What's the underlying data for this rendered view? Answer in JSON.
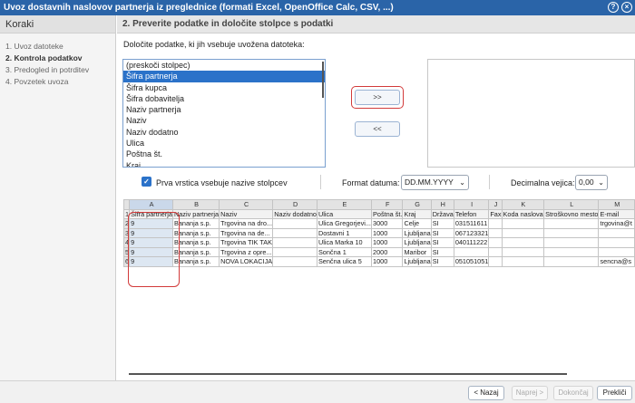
{
  "window": {
    "title": "Uvoz dostavnih naslovov partnerja iz preglednice (formati Excel, OpenOffice Calc, CSV, ...)",
    "help_icon": "?",
    "close_icon": "×"
  },
  "steps": {
    "title": "Koraki",
    "items": [
      {
        "label": "1. Uvoz datoteke"
      },
      {
        "label": "2. Kontrola podatkov"
      },
      {
        "label": "3. Predogled in potrditev"
      },
      {
        "label": "4. Povzetek uvoza"
      }
    ]
  },
  "main": {
    "header": "2. Preverite podatke in določite stolpce s podatki",
    "instruction": "Določite podatke, ki jih vsebuje uvožena datoteka:",
    "fields": [
      {
        "label": "(preskoči stolpec)"
      },
      {
        "label": "Šifra partnerja"
      },
      {
        "label": "Šifra kupca"
      },
      {
        "label": "Šifra dobavitelja"
      },
      {
        "label": "Naziv partnerja"
      },
      {
        "label": "Naziv"
      },
      {
        "label": "Naziv dodatno"
      },
      {
        "label": "Ulica"
      },
      {
        "label": "Poštna št."
      },
      {
        "label": "Kraj"
      }
    ],
    "add_button": ">>",
    "remove_button": "<<",
    "first_row_checkbox": "Prva vrstica vsebuje nazive stolpcev",
    "checkmark": "✓",
    "date_format_label": "Format datuma:",
    "date_format_value": "DD.MM.YYYY",
    "decimal_label": "Decimalna vejica:",
    "decimal_value": "0,00",
    "chevron": "⌄"
  },
  "grid": {
    "letters": [
      "A",
      "B",
      "C",
      "D",
      "E",
      "F",
      "G",
      "H",
      "I",
      "J",
      "K",
      "L",
      "M"
    ],
    "rows": [
      {
        "num": "1",
        "cells": [
          "Šifra partnerja",
          "Naziv partnerja",
          "Naziv",
          "Naziv dodatno",
          "Ulica",
          "Poštna št.",
          "Kraj",
          "Država",
          "Telefon",
          "Fax",
          "Koda naslova",
          "Stroškovno mesto",
          "E-mail"
        ]
      },
      {
        "num": "2",
        "cells": [
          "9",
          "Bananja s.p.",
          "Trgovina na dro...",
          "",
          "Ulica Gregorjevi...",
          "3000",
          "Celje",
          "SI",
          "031511611",
          "",
          "",
          "",
          "trgovina@t"
        ]
      },
      {
        "num": "3",
        "cells": [
          "9",
          "Bananja s.p.",
          "Trgovina na de...",
          "",
          "Dostavni 1",
          "1000",
          "Ljubljana",
          "SI",
          "067123321",
          "",
          "",
          "",
          ""
        ]
      },
      {
        "num": "4",
        "cells": [
          "9",
          "Bananja s.p.",
          "Trgovina TIK TAK",
          "",
          "Ulica Marka 10",
          "1000",
          "Ljubljana",
          "SI",
          "040111222",
          "",
          "",
          "",
          ""
        ]
      },
      {
        "num": "5",
        "cells": [
          "9",
          "Bananja s.p.",
          "Trgovina z opre...",
          "",
          "Sončna 1",
          "2000",
          "Maribor",
          "SI",
          "",
          "",
          "",
          "",
          ""
        ]
      },
      {
        "num": "6",
        "cells": [
          "9",
          "Bananja s.p.",
          "NOVA LOKACIJA",
          "",
          "Senčna ulica 5",
          "1000",
          "Ljubljana",
          "SI",
          "051051051",
          "",
          "",
          "",
          "sencna@s"
        ]
      }
    ]
  },
  "footer": {
    "back": "< Nazaj",
    "next": "Naprej >",
    "finish": "Dokončaj",
    "cancel": "Prekliči"
  }
}
